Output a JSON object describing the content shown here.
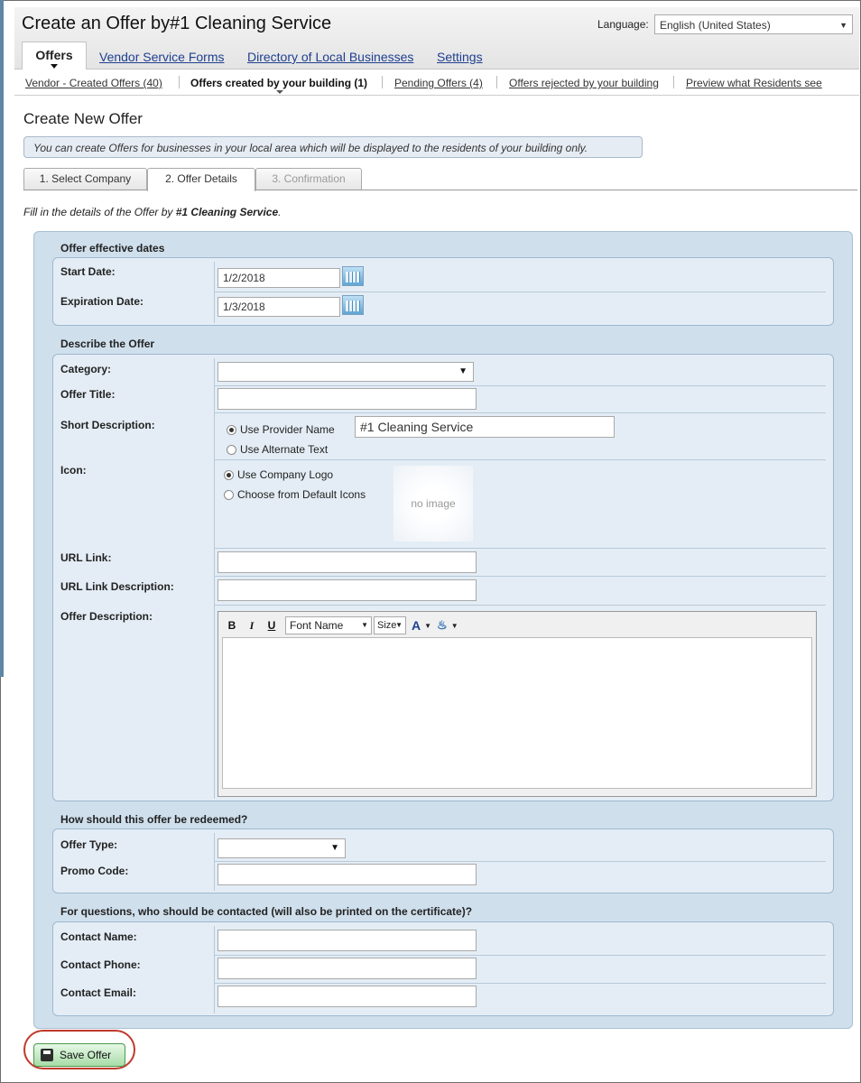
{
  "header": {
    "title": "Create an Offer by#1 Cleaning Service",
    "language_label": "Language:",
    "language_value": "English (United States)"
  },
  "top_tabs": [
    {
      "label": "Offers"
    },
    {
      "label": "Vendor Service Forms"
    },
    {
      "label": "Directory of Local Businesses"
    },
    {
      "label": "Settings"
    }
  ],
  "sub_tabs": [
    {
      "label": "Vendor - Created Offers (40)"
    },
    {
      "label": "Offers created by your building (1)"
    },
    {
      "label": "Pending Offers (4)"
    },
    {
      "label": "Offers rejected by your building"
    },
    {
      "label": "Preview what Residents see"
    }
  ],
  "page": {
    "title": "Create New Offer",
    "info": "You can create Offers for businesses in your local area which will be displayed to the residents of your building only.",
    "fill_prefix": "Fill in the details of the Offer by ",
    "fill_company": "#1 Cleaning Service",
    "fill_suffix": "."
  },
  "steps": [
    {
      "label": "1. Select Company"
    },
    {
      "label": "2. Offer Details"
    },
    {
      "label": "3. Confirmation"
    }
  ],
  "dates": {
    "section": "Offer effective dates",
    "start_label": "Start Date:",
    "start_value": "1/2/2018",
    "exp_label": "Expiration Date:",
    "exp_value": "1/3/2018"
  },
  "describe": {
    "section": "Describe the Offer",
    "category_label": "Category:",
    "title_label": "Offer Title:",
    "short_label": "Short Description:",
    "use_provider": "Use Provider Name",
    "provider_value": "#1 Cleaning Service",
    "use_alt": "Use Alternate Text",
    "icon_label": "Icon:",
    "use_logo": "Use Company Logo",
    "choose_default": "Choose from Default Icons",
    "no_image": "no image",
    "url_label": "URL Link:",
    "url_desc_label": "URL Link Description:",
    "offer_desc_label": "Offer Description:"
  },
  "editor": {
    "bold": "B",
    "italic": "I",
    "underline": "U",
    "font": "Font Name",
    "size": "Size",
    "font_color": "A"
  },
  "redeem": {
    "section": "How should this offer be redeemed?",
    "type_label": "Offer Type:",
    "promo_label": "Promo Code:"
  },
  "contact": {
    "section": "For questions, who should be contacted (will also be printed on the certificate)?",
    "name_label": "Contact Name:",
    "phone_label": "Contact Phone:",
    "email_label": "Contact Email:"
  },
  "save_label": "Save Offer"
}
